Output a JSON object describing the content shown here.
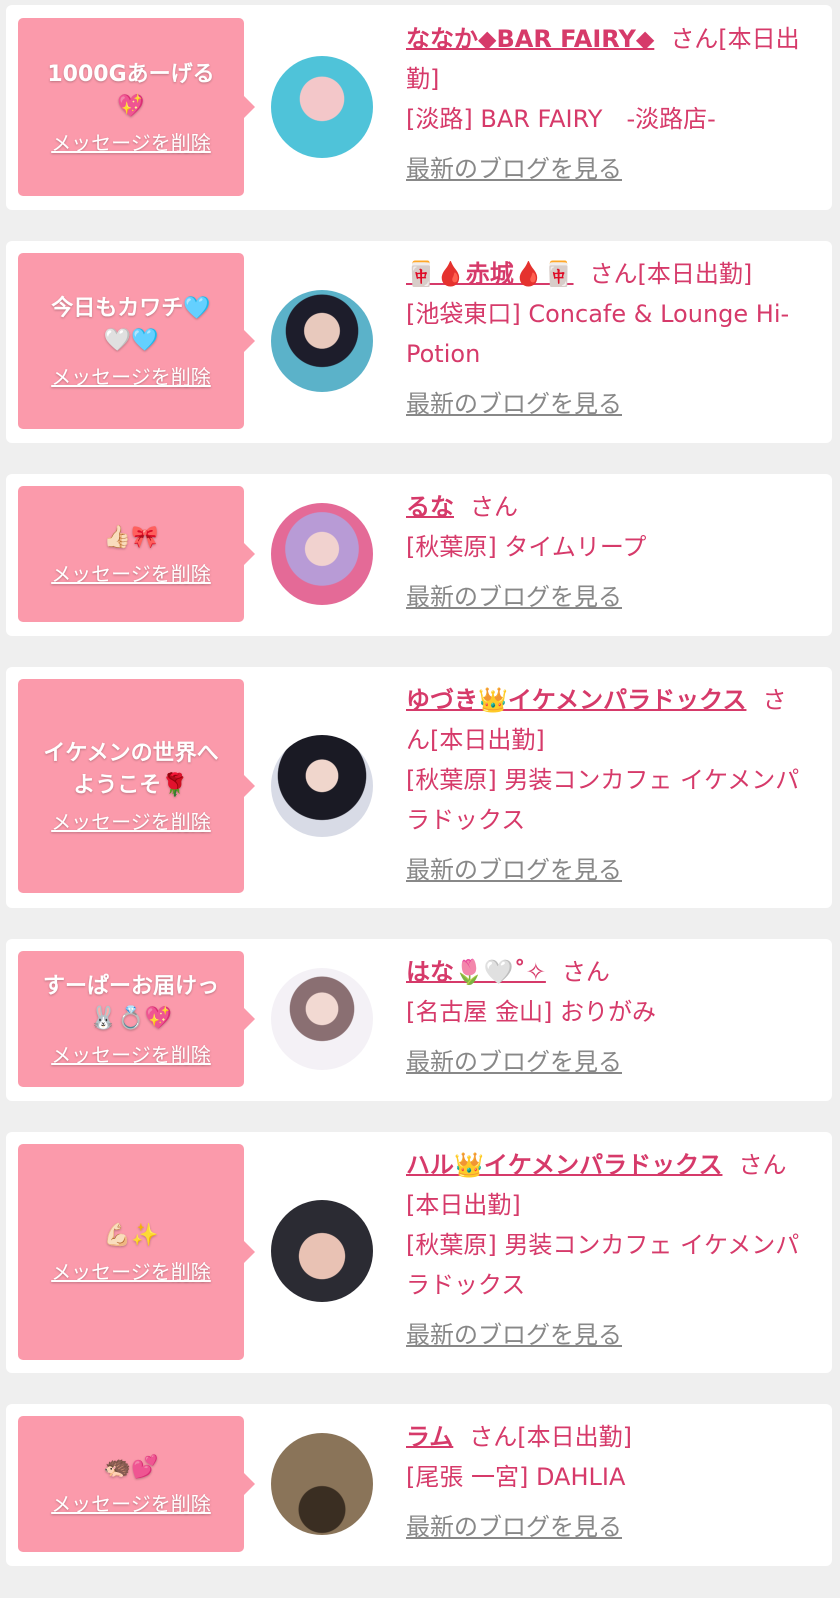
{
  "entries": [
    {
      "message": "1000Gあーげる\n💖",
      "delete_label": "メッセージを削除",
      "name": "ななか◆BAR FAIRY◆",
      "suffix": "さん[本日出勤]",
      "shop": "[淡路] BAR FAIRY　-淡路店-",
      "blog_label": "最新のブログを見る",
      "avatar_colors": [
        "#4fc3d9",
        "#f3c7c9"
      ]
    },
    {
      "message": "今日もカワチ🩵\n🤍🩵",
      "delete_label": "メッセージを削除",
      "name": "🀄🩸赤城🩸🀄",
      "suffix": "さん[本日出勤]",
      "shop": "[池袋東口] Concafe & Lounge Hi-Potion",
      "blog_label": "最新のブログを見る",
      "avatar_colors": [
        "#5bb2c9",
        "#1d1d2b"
      ]
    },
    {
      "message": "👍🏻🎀",
      "delete_label": "メッセージを削除",
      "name": "るな",
      "suffix": "さん",
      "shop": "[秋葉原] タイムリープ",
      "blog_label": "最新のブログを見る",
      "avatar_colors": [
        "#e46a97",
        "#b89bd6"
      ]
    },
    {
      "message": "イケメンの世界へ\nようこそ🌹",
      "delete_label": "メッセージを削除",
      "name": "ゆづき👑イケメンパラドックス",
      "suffix": "さん[本日出勤]",
      "shop": "[秋葉原] 男装コンカフェ イケメンパラドックス",
      "blog_label": "最新のブログを見る",
      "avatar_colors": [
        "#d8dbe6",
        "#1a1a24"
      ]
    },
    {
      "message": "すーぱーお届けっ\n🐰💍💖",
      "delete_label": "メッセージを削除",
      "name": "はな🌷🤍˚✧",
      "suffix": "さん",
      "shop": "[名古屋 金山] おりがみ",
      "blog_label": "最新のブログを見る",
      "avatar_colors": [
        "#f4f1f6",
        "#8a6f72"
      ]
    },
    {
      "message": "💪🏻✨",
      "delete_label": "メッセージを削除",
      "name": "ハル👑イケメンパラドックス",
      "suffix": "さん[本日出勤]",
      "shop": "[秋葉原] 男装コンカフェ イケメンパラドックス",
      "blog_label": "最新のブログを見る",
      "avatar_colors": [
        "#2b2b33",
        "#e9c2b4"
      ]
    },
    {
      "message": "🦔💕",
      "delete_label": "メッセージを削除",
      "name": "ラム",
      "suffix": "さん[本日出勤]",
      "shop": "[尾張 一宮] DAHLIA",
      "blog_label": "最新のブログを見る",
      "avatar_colors": [
        "#8a7459",
        "#3a2e22"
      ]
    }
  ]
}
